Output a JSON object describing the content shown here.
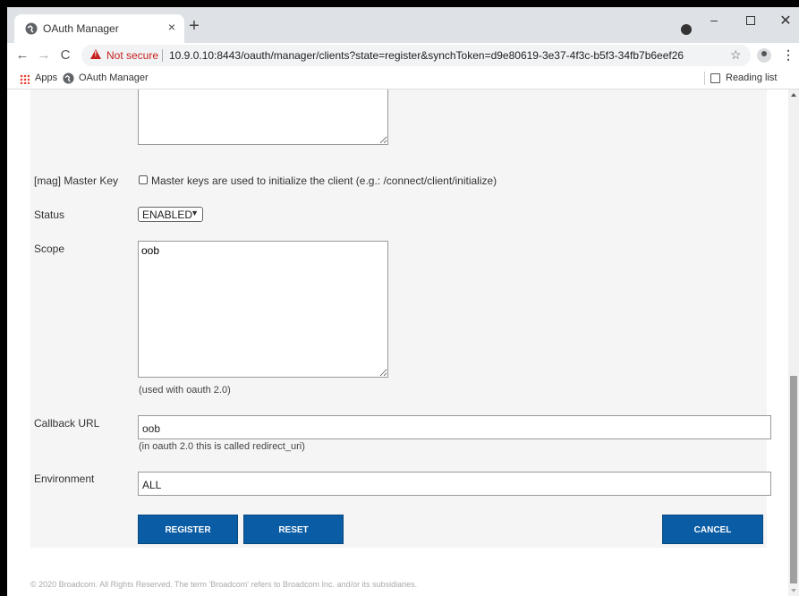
{
  "browser": {
    "tab_title": "OAuth Manager",
    "tab_close": "×",
    "new_tab": "+",
    "min": "–",
    "close": "✕",
    "back": "←",
    "forward": "→",
    "reload": "C",
    "not_secure": "Not secure",
    "url": "10.9.0.10:8443/oauth/manager/clients?state=register&synchToken=d9e80619-3e37-4f3c-b5f3-34fb7b6eef26",
    "star": "☆",
    "menu": "⋮"
  },
  "bookmarks": {
    "apps_label": "Apps",
    "oauth_label": "OAuth Manager",
    "reading_list": "Reading list"
  },
  "form": {
    "master_key_label": "[mag] Master Key",
    "master_key_checkbox_text": "Master keys are used to initialize the client (e.g.: /connect/client/initialize)",
    "status_label": "Status",
    "status_value": "ENABLED",
    "scope_label": "Scope",
    "scope_value": "oob",
    "scope_hint": "(used with oauth 2.0)",
    "callback_label": "Callback URL",
    "callback_value": "oob",
    "callback_hint": "(in oauth 2.0 this is called redirect_uri)",
    "environment_label": "Environment",
    "environment_value": "ALL",
    "register_label": "REGISTER",
    "reset_label": "RESET",
    "cancel_label": "CANCEL"
  },
  "footer": "© 2020 Broadcom. All Rights Reserved. The term 'Broadcom' refers to Broadcom Inc. and/or its subsidiaries."
}
